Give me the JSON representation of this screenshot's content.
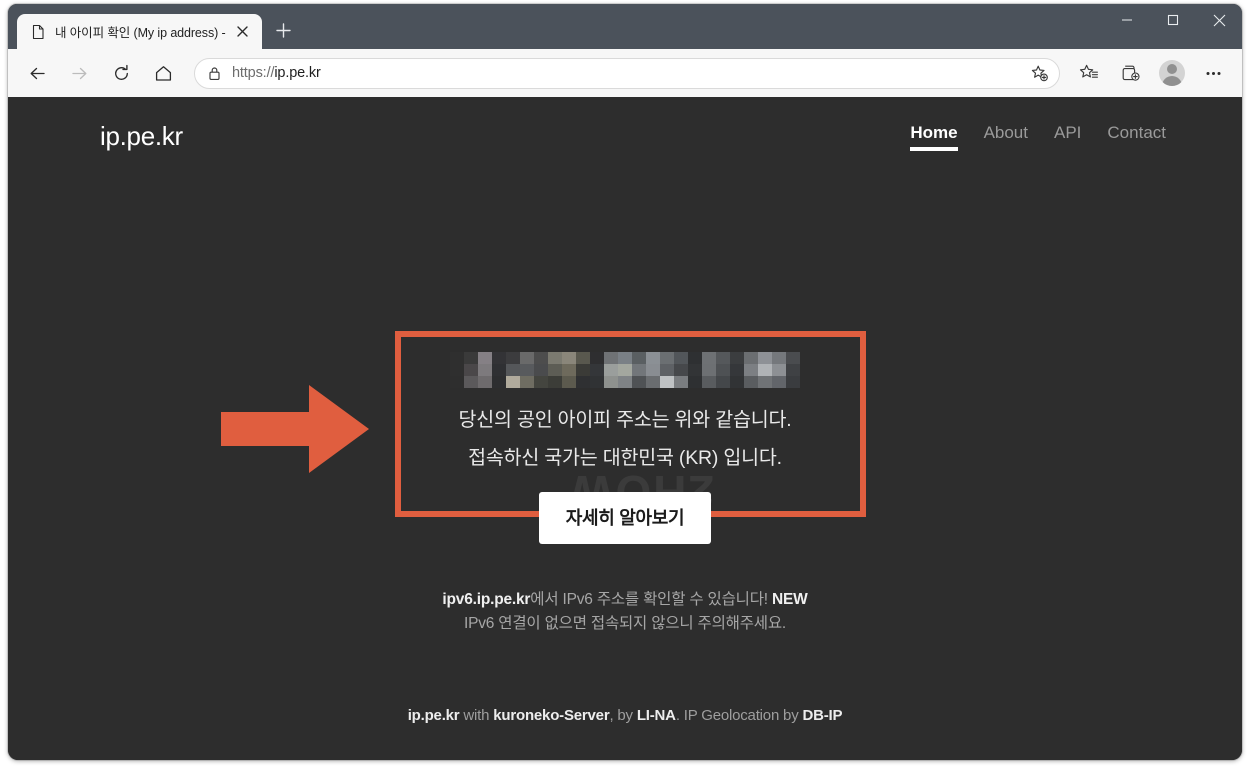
{
  "browser": {
    "tab": {
      "title": "내 아이피 확인 (My ip address) -",
      "favicon_icon": "page-icon",
      "close_icon": "close-icon"
    },
    "new_tab_icon": "plus-icon",
    "window_controls": {
      "minimize_icon": "minimize-icon",
      "maximize_icon": "maximize-icon",
      "close_icon": "close-icon"
    },
    "toolbar": {
      "back_icon": "back-arrow-icon",
      "forward_icon": "forward-arrow-icon",
      "refresh_icon": "refresh-icon",
      "home_icon": "home-icon",
      "lock_icon": "lock-icon",
      "url_scheme": "https://",
      "url_host": "ip.pe.kr",
      "url_full": "https://ip.pe.kr",
      "add_favorite_icon": "star-plus-icon",
      "favorites_icon": "favorites-list-icon",
      "collections_icon": "collections-icon",
      "profile_icon": "profile-avatar-icon",
      "settings_icon": "ellipsis-icon"
    }
  },
  "page": {
    "logo": "ip.pe.kr",
    "nav": [
      {
        "label": "Home",
        "active": true
      },
      {
        "label": "About",
        "active": false
      },
      {
        "label": "API",
        "active": false
      },
      {
        "label": "Contact",
        "active": false
      }
    ],
    "annotation": {
      "arrow_icon": "right-arrow-annotation-icon",
      "arrow_color": "#e05e3f",
      "highlight_border_color": "#e05e3f"
    },
    "ip_display": {
      "value": "",
      "redacted": true,
      "note": "IP address is pixelated/mosaic-blurred in the screenshot"
    },
    "info_line_1": "당신의 공인 아이피 주소는 위와 같습니다.",
    "info_line_2": "접속하신 국가는 대한민국 (KR) 입니다.",
    "learn_more_label": "자세히 알아보기",
    "watermark": "2HOW",
    "ipv6": {
      "line1_strong": "ipv6.ip.pe.kr",
      "line1_mid": "에서 IPv6 주소를 확인할 수 있습니다! ",
      "line1_badge": "NEW",
      "line2": "IPv6 연결이 없으면 접속되지 않으니 주의해주세요."
    },
    "footer": {
      "part1_strong": "ip.pe.kr",
      "part2": " with ",
      "part3_strong": "kuroneko-Server",
      "part4": ", by ",
      "part5_strong": "LI-NA",
      "part6": ". IP Geolocation by ",
      "part7_strong": "DB-IP"
    }
  }
}
